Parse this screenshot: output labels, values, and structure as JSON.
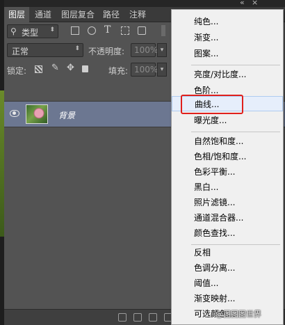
{
  "panel": {
    "title_controls": {
      "collapse": "«",
      "close": "×"
    },
    "tabs": [
      {
        "label": "图层",
        "active": true
      },
      {
        "label": "通道",
        "active": false
      },
      {
        "label": "图层复合",
        "active": false
      },
      {
        "label": "路径",
        "active": false
      },
      {
        "label": "注释",
        "active": false
      }
    ],
    "filter": {
      "kind_label": "类型"
    },
    "blend": {
      "mode": "正常",
      "opacity_label": "不透明度:",
      "opacity_value": "100%"
    },
    "lock": {
      "label": "锁定:",
      "fill_label": "填充:",
      "fill_value": "100%"
    },
    "layers": [
      {
        "name": "背景",
        "visible": true,
        "locked": true
      }
    ]
  },
  "menu": {
    "groups": [
      [
        "纯色...",
        "渐变...",
        "图案..."
      ],
      [
        "亮度/对比度...",
        "色阶...",
        "曲线...",
        "曝光度..."
      ],
      [
        "自然饱和度...",
        "色相/饱和度...",
        "色彩平衡...",
        "黑白...",
        "照片滤镜...",
        "通道混合器...",
        "颜色查找..."
      ],
      [
        "反相",
        "色调分离...",
        "阈值...",
        "渐变映射...",
        "可选颜色..."
      ]
    ],
    "highlighted_item": "曲线..."
  },
  "watermark": "@图图图世界",
  "colors": {
    "accent_highlight": "#e0201c",
    "selected_layer": "#6c7791",
    "menu_bg": "#f0f0f0"
  }
}
